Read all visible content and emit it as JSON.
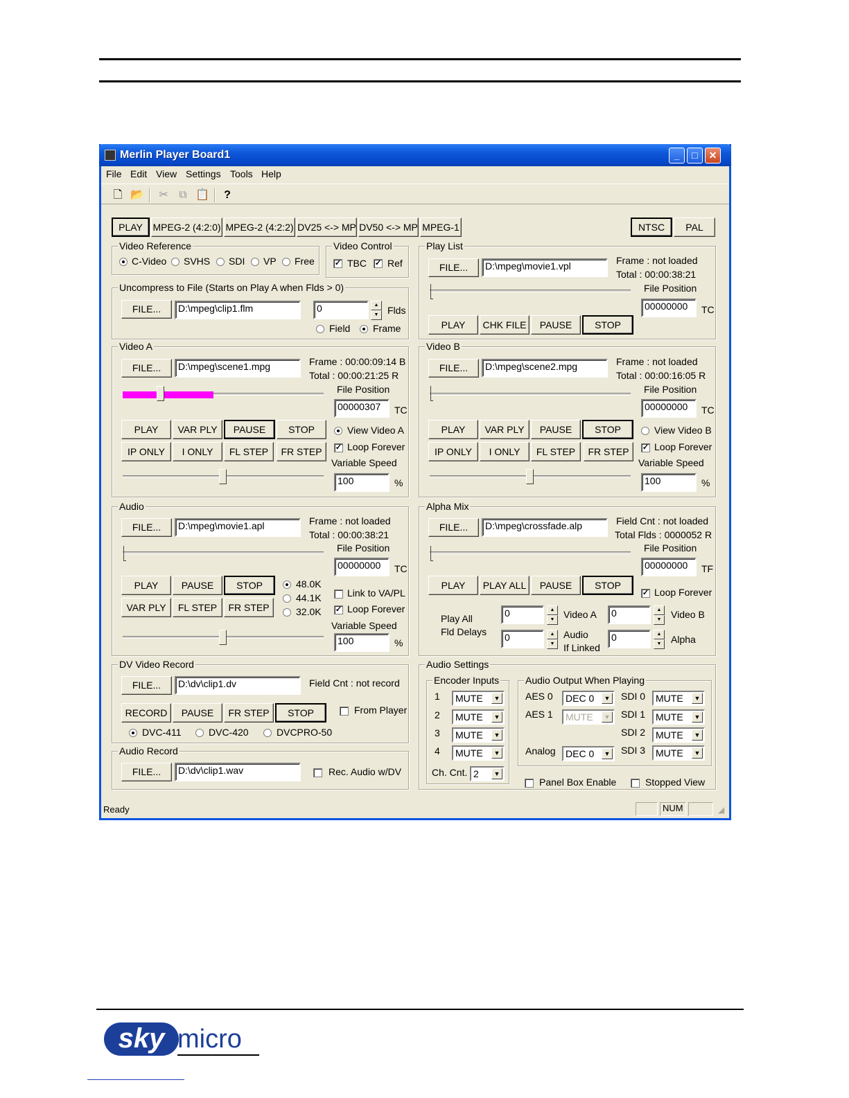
{
  "window": {
    "title": "Merlin Player Board1",
    "controls": {
      "minimize": "_",
      "maximize": "□",
      "close": "✕"
    }
  },
  "menu": [
    "File",
    "Edit",
    "View",
    "Settings",
    "Tools",
    "Help"
  ],
  "toolbar_icons": [
    "new-file-icon",
    "open-folder-icon",
    "cut-icon",
    "copy-icon",
    "paste-icon",
    "help-icon"
  ],
  "mode_buttons": [
    "PLAY",
    "MPEG-2 (4:2:0)",
    "MPEG-2 (4:2:2)",
    "DV25 <-> MP",
    "DV50 <-> MP",
    "MPEG-1"
  ],
  "standard_buttons": [
    "NTSC",
    "PAL"
  ],
  "video_reference": {
    "title": "Video Reference",
    "options": [
      "C-Video",
      "SVHS",
      "SDI",
      "VP",
      "Free"
    ],
    "selected": "C-Video"
  },
  "video_control": {
    "title": "Video Control",
    "tbc": "TBC",
    "ref": "Ref"
  },
  "uncompress": {
    "title": "Uncompress to File (Starts on Play A when Flds > 0)",
    "file_button": "FILE...",
    "path": "D:\\mpeg\\clip1.flm",
    "flds_value": "0",
    "flds_label": "Flds",
    "field_label": "Field",
    "frame_label": "Frame"
  },
  "play_list": {
    "title": "Play List",
    "file_button": "FILE...",
    "path": "D:\\mpeg\\movie1.vpl",
    "frame": "Frame :  not loaded",
    "total": "Total  :   00:00:38:21",
    "file_position_label": "File Position",
    "position": "00000000",
    "unit": "TC",
    "buttons": [
      "PLAY",
      "CHK FILE",
      "PAUSE",
      "STOP"
    ]
  },
  "video_a": {
    "title": "Video A",
    "file_button": "FILE...",
    "path": "D:\\mpeg\\scene1.mpg",
    "frame": "Frame :  00:00:09:14  B",
    "total": "Total  :   00:00:21:25  R",
    "file_position_label": "File Position",
    "position": "00000307",
    "unit": "TC",
    "row1": [
      "PLAY",
      "VAR PLY",
      "PAUSE",
      "STOP"
    ],
    "row2": [
      "IP ONLY",
      "I ONLY",
      "FL STEP",
      "FR STEP"
    ],
    "view_label": "View Video A",
    "loop_label": "Loop Forever",
    "variable_speed_label": "Variable Speed",
    "speed": "100",
    "speed_unit": "%",
    "buffer_fill": 0.45,
    "position_fraction": 0.17
  },
  "video_b": {
    "title": "Video B",
    "file_button": "FILE...",
    "path": "D:\\mpeg\\scene2.mpg",
    "frame": "Frame :  not loaded",
    "total": "Total  :   00:00:16:05  R",
    "file_position_label": "File Position",
    "position": "00000000",
    "unit": "TC",
    "row1": [
      "PLAY",
      "VAR PLY",
      "PAUSE",
      "STOP"
    ],
    "row2": [
      "IP ONLY",
      "I ONLY",
      "FL STEP",
      "FR STEP"
    ],
    "view_label": "View Video B",
    "loop_label": "Loop Forever",
    "variable_speed_label": "Variable Speed",
    "speed": "100",
    "speed_unit": "%"
  },
  "audio": {
    "title": "Audio",
    "file_button": "FILE...",
    "path": "D:\\mpeg\\movie1.apl",
    "frame": "Frame :  not loaded",
    "total": "Total  :   00:00:38:21",
    "file_position_label": "File Position",
    "position": "00000000",
    "unit": "TC",
    "row1": [
      "PLAY",
      "PAUSE",
      "STOP"
    ],
    "row2": [
      "VAR PLY",
      "FL STEP",
      "FR STEP"
    ],
    "rates": [
      "48.0K",
      "44.1K",
      "32.0K"
    ],
    "link_label": "Link to VA/PL",
    "loop_label": "Loop Forever",
    "variable_speed_label": "Variable Speed",
    "speed": "100",
    "speed_unit": "%"
  },
  "alpha_mix": {
    "title": "Alpha Mix",
    "file_button": "FILE...",
    "path": "D:\\mpeg\\crossfade.alp",
    "field_cnt": "Field Cnt  :  not loaded",
    "total_flds": "Total Flds :  0000052 R",
    "file_position_label": "File Position",
    "position": "00000000",
    "unit": "TF",
    "buttons": [
      "PLAY",
      "PLAY ALL",
      "PAUSE",
      "STOP"
    ],
    "loop_label": "Loop Forever",
    "play_all_label_1": "Play All",
    "play_all_label_2": "Fld Delays",
    "delay_video_a": "0",
    "delay_video_b": "0",
    "delay_audio": "0",
    "delay_alpha": "0",
    "video_a_label": "Video A",
    "video_b_label": "Video B",
    "audio_label_1": "Audio",
    "audio_label_2": "If Linked",
    "alpha_label": "Alpha"
  },
  "dv_record": {
    "title": "DV Video Record",
    "file_button": "FILE...",
    "path": "D:\\dv\\clip1.dv",
    "field_cnt": "Field Cnt  :  not record",
    "buttons": [
      "RECORD",
      "PAUSE",
      "FR STEP",
      "STOP"
    ],
    "from_player": "From Player",
    "formats": [
      "DVC-411",
      "DVC-420",
      "DVCPRO-50"
    ]
  },
  "audio_record": {
    "title": "Audio Record",
    "file_button": "FILE...",
    "path": "D:\\dv\\clip1.wav",
    "rec_label": "Rec. Audio w/DV"
  },
  "audio_settings": {
    "title": "Audio Settings",
    "encoder_title": "Encoder Inputs",
    "encoders": [
      {
        "num": "1",
        "value": "MUTE"
      },
      {
        "num": "2",
        "value": "MUTE"
      },
      {
        "num": "3",
        "value": "MUTE"
      },
      {
        "num": "4",
        "value": "MUTE"
      }
    ],
    "ch_cnt_label": "Ch. Cnt.",
    "ch_cnt": "2",
    "output_title": "Audio Output When Playing",
    "aes0_label": "AES 0",
    "aes0": "DEC 0",
    "aes1_label": "AES 1",
    "aes1": "MUTE",
    "analog_label": "Analog",
    "analog": "DEC 0",
    "sdi": [
      {
        "label": "SDI 0",
        "value": "MUTE"
      },
      {
        "label": "SDI 1",
        "value": "MUTE"
      },
      {
        "label": "SDI 2",
        "value": "MUTE"
      },
      {
        "label": "SDI 3",
        "value": "MUTE"
      }
    ],
    "panel_box": "Panel Box Enable",
    "stopped_view": "Stopped View"
  },
  "status": {
    "text": "Ready",
    "num": "NUM"
  },
  "footer": {
    "logo_sky": "sky",
    "logo_micro": "micro"
  },
  "colors": {
    "buffer_fill": "#ff00ff",
    "title_bar": "#0a54e3",
    "window_bg": "#ece9d8",
    "logo_blue": "#1c3f9a"
  }
}
